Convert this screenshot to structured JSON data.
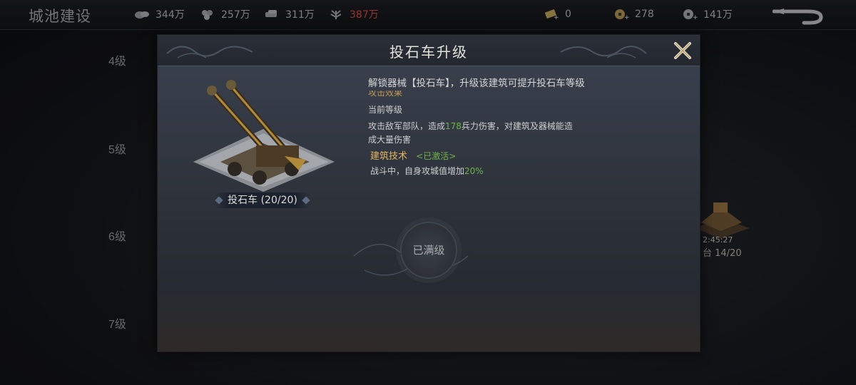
{
  "header": {
    "title": "城池建设",
    "resources": [
      {
        "icon": "wood-icon",
        "value": "344万"
      },
      {
        "icon": "stone-icon",
        "value": "257万"
      },
      {
        "icon": "iron-icon",
        "value": "311万"
      },
      {
        "icon": "grain-icon",
        "value": "387万"
      }
    ],
    "currencies": [
      {
        "icon": "gold-bar-icon",
        "value": "0"
      },
      {
        "icon": "copper-coin-icon",
        "value": "278"
      },
      {
        "icon": "silver-coin-icon",
        "value": "141万"
      }
    ]
  },
  "background": {
    "levels": [
      "4级",
      "5级",
      "6级",
      "7级"
    ],
    "building_timer": "2:45:27",
    "building_name": "台 14/20"
  },
  "modal": {
    "title": "投石车升级",
    "building_name": "投石车 (20/20)",
    "intro": "解锁器械【投石车】，升级该建筑可提升投石车等级",
    "cut_heading": "攻击效果",
    "current_level_label": "当前等级",
    "effect_text_a": "攻击敌军部队，造成",
    "effect_value": "178",
    "effect_text_b": "兵力伤害，对建筑及器械能造",
    "effect_text_c": "成大量伤害",
    "tech_title": "建筑技术",
    "tech_state": "<已激活>",
    "tech_text": "战斗中，自身攻城值增加",
    "tech_value": "20%",
    "max_button": "已满级"
  },
  "colors": {
    "accent_gold": "#e4b55e",
    "highlight_green": "#6fb24a",
    "warning_red": "#c9463c"
  }
}
